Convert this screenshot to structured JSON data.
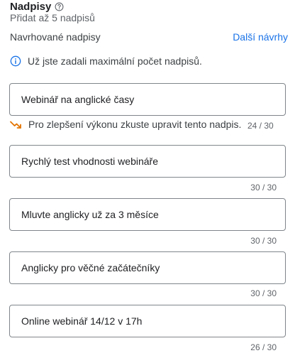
{
  "section": {
    "title": "Nadpisy",
    "subtitle": "Přidat až 5 nadpisů",
    "suggested_label": "Navrhované nadpisy",
    "more_link": "Další návrhy"
  },
  "info": {
    "text": "Už jste zadali maximální počet nadpisů."
  },
  "headlines": [
    {
      "value": "Webinář na anglické časy",
      "counter": "24 / 30",
      "warning": "Pro zlepšení výkonu zkuste upravit tento nadpis."
    },
    {
      "value": "Rychlý test vhodnosti webináře",
      "counter": "30 / 30"
    },
    {
      "value": "Mluvte anglicky už za 3 měsíce",
      "counter": "30 / 30"
    },
    {
      "value": "Anglicky pro věčné začátečníky",
      "counter": "30 / 30"
    },
    {
      "value": "Online webinář 14/12 v 17h",
      "counter": "26 / 30"
    }
  ],
  "icons": {
    "help": "help-circle-icon",
    "info": "info-icon",
    "warning": "trending-down-icon"
  },
  "colors": {
    "link": "#1a73e8",
    "info": "#1a73e8",
    "warning": "#e37400",
    "border": "#80868b"
  }
}
